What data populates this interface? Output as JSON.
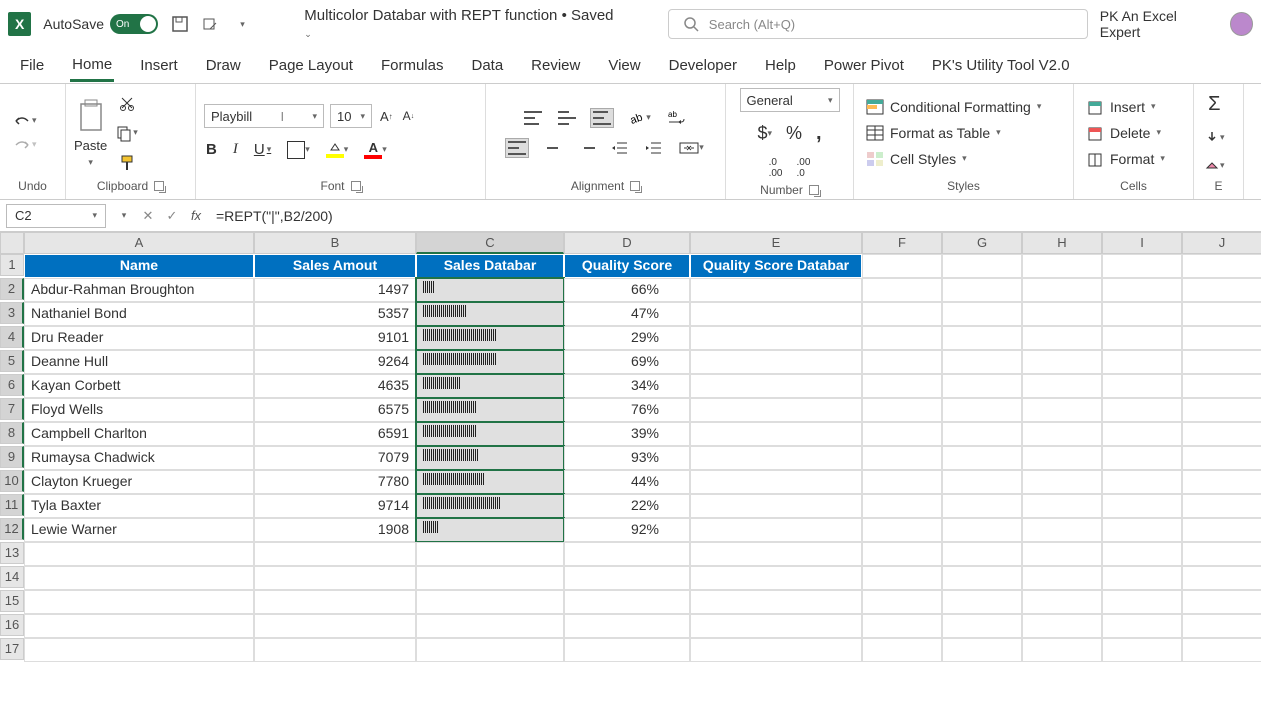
{
  "titlebar": {
    "autosave_label": "AutoSave",
    "autosave_state": "On",
    "doc_title": "Multicolor Databar with REPT function • Saved",
    "search_placeholder": "Search (Alt+Q)",
    "user_name": "PK An Excel Expert"
  },
  "tabs": [
    "File",
    "Home",
    "Insert",
    "Draw",
    "Page Layout",
    "Formulas",
    "Data",
    "Review",
    "View",
    "Developer",
    "Help",
    "Power Pivot",
    "PK's Utility Tool V2.0"
  ],
  "active_tab": "Home",
  "ribbon": {
    "undo_label": "Undo",
    "clipboard_label": "Clipboard",
    "paste_label": "Paste",
    "font_label": "Font",
    "font_name": "Playbill",
    "font_size": "10",
    "alignment_label": "Alignment",
    "number_label": "Number",
    "number_format": "General",
    "styles_label": "Styles",
    "cond_fmt": "Conditional Formatting",
    "fmt_table": "Format as Table",
    "cell_styles": "Cell Styles",
    "cells_label": "Cells",
    "insert": "Insert",
    "delete": "Delete",
    "format": "Format"
  },
  "formula_bar": {
    "name_box": "C2",
    "formula": "=REPT(\"|\",B2/200)"
  },
  "columns": [
    "A",
    "B",
    "C",
    "D",
    "E",
    "F",
    "G",
    "H",
    "I",
    "J"
  ],
  "headers": [
    "Name",
    "Sales Amout",
    "Sales Databar",
    "Quality Score",
    "Quality Score Databar"
  ],
  "rows": [
    {
      "name": "Abdur-Rahman Broughton",
      "sales": "1497",
      "bar": 7,
      "quality": "66%"
    },
    {
      "name": "Nathaniel Bond",
      "sales": "5357",
      "bar": 27,
      "quality": "47%"
    },
    {
      "name": "Dru Reader",
      "sales": "9101",
      "bar": 46,
      "quality": "29%"
    },
    {
      "name": "Deanne Hull",
      "sales": "9264",
      "bar": 46,
      "quality": "69%"
    },
    {
      "name": "Kayan Corbett",
      "sales": "4635",
      "bar": 23,
      "quality": "34%"
    },
    {
      "name": "Floyd Wells",
      "sales": "6575",
      "bar": 33,
      "quality": "76%"
    },
    {
      "name": "Campbell Charlton",
      "sales": "6591",
      "bar": 33,
      "quality": "39%"
    },
    {
      "name": "Rumaysa Chadwick",
      "sales": "7079",
      "bar": 35,
      "quality": "93%"
    },
    {
      "name": "Clayton Krueger",
      "sales": "7780",
      "bar": 39,
      "quality": "44%"
    },
    {
      "name": "Tyla Baxter",
      "sales": "9714",
      "bar": 49,
      "quality": "22%"
    },
    {
      "name": "Lewie Warner",
      "sales": "1908",
      "bar": 10,
      "quality": "92%"
    }
  ]
}
